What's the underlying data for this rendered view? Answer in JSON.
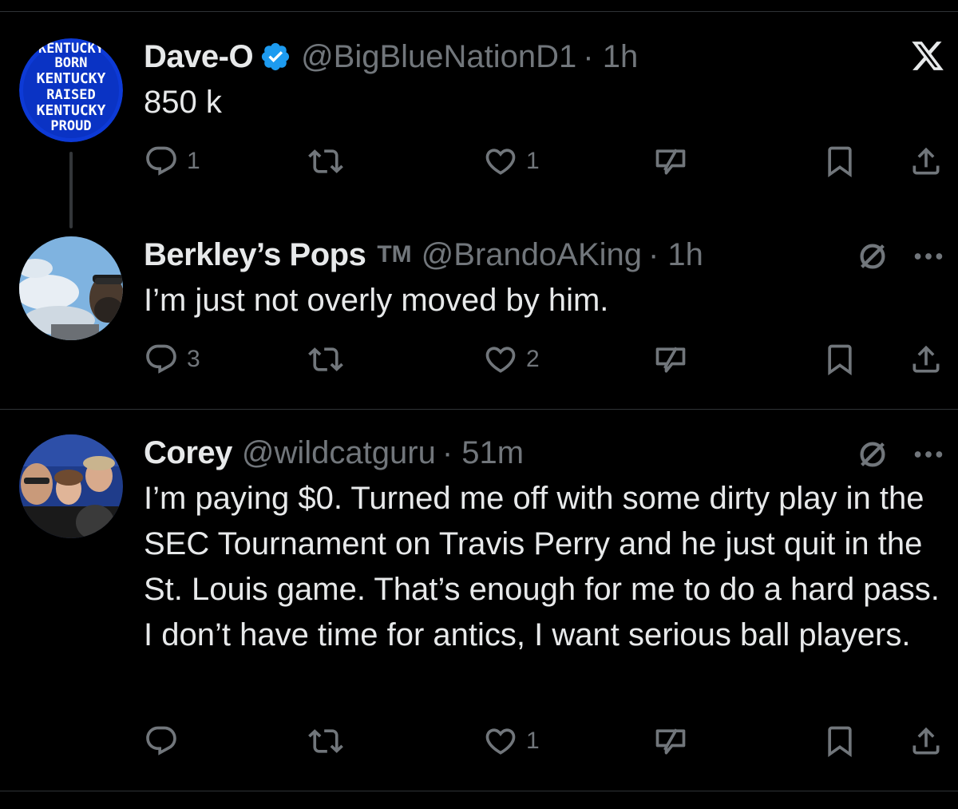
{
  "colors": {
    "background": "#000000",
    "text": "#e7e9ea",
    "muted": "#71767b",
    "verified": "#1d9bf0",
    "divider": "#2f3336"
  },
  "close_icon": "x-icon",
  "tweets": [
    {
      "name": "Dave-O",
      "verified": true,
      "handle": "@BigBlueNationD1",
      "time": "· 1h",
      "text": "850 k",
      "avatar_text": [
        "KENTUCKY",
        "BORN",
        "KENTUCKY",
        "RAISED",
        "KENTUCKY",
        "PROUD"
      ],
      "replies": "1",
      "reposts": "",
      "likes": "1"
    },
    {
      "name": "Berkley’s Pops",
      "badge": "TM",
      "handle": "@BrandoAKing",
      "time": "· 1h",
      "text": "I’m just not overly moved by him.",
      "replies": "3",
      "reposts": "",
      "likes": "2"
    },
    {
      "name": "Corey",
      "handle": "@wildcatguru",
      "time": "· 51m",
      "text": "I’m paying $0. Turned me off with some dirty play in the SEC Tournament on Travis Perry and he just quit in the St. Louis game. That’s enough for me to do a hard pass. I don’t have time for antics, I want serious ball players.",
      "replies": "",
      "reposts": "",
      "likes": "1"
    }
  ]
}
